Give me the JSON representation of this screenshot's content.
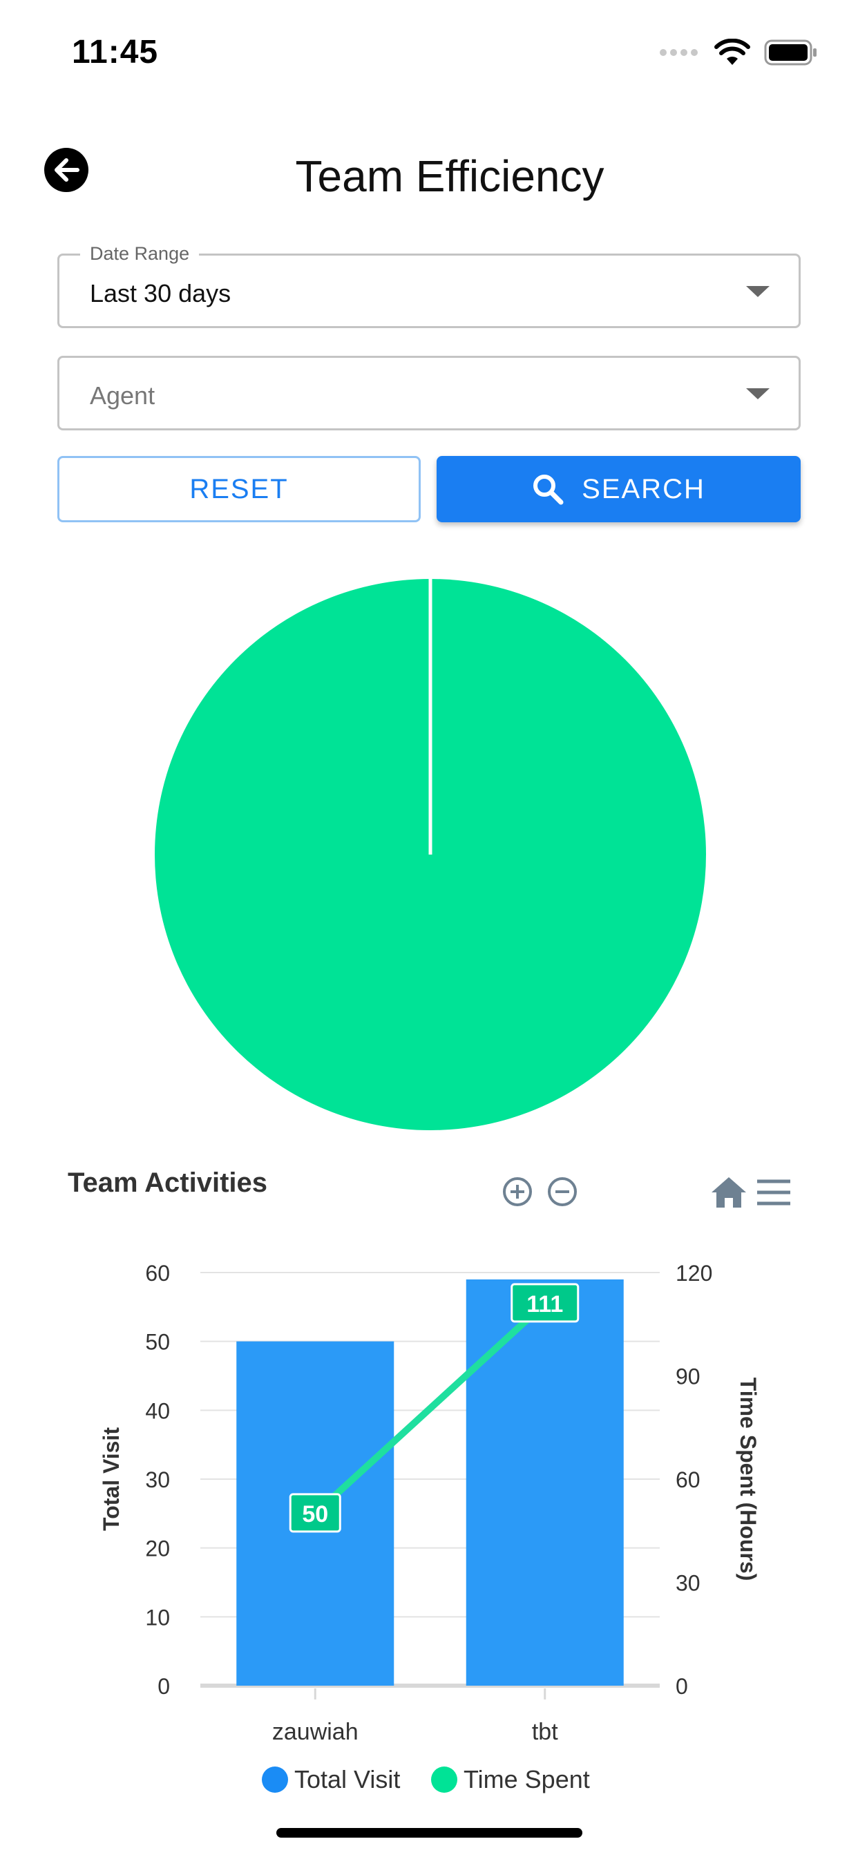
{
  "status_bar": {
    "time": "11:45"
  },
  "header": {
    "title": "Team Efficiency",
    "back_icon": "arrow-left-icon"
  },
  "filters": {
    "date_range": {
      "label": "Date Range",
      "value": "Last 30 days"
    },
    "agent": {
      "placeholder": "Agent",
      "value": ""
    }
  },
  "buttons": {
    "reset_label": "RESET",
    "search_label": "SEARCH"
  },
  "colors": {
    "accent": "#1a7ef2",
    "pie_green": "#00e396",
    "bar_blue": "#2b9af7",
    "line_green": "#1fdf9f"
  },
  "pie": {
    "slices": [
      {
        "label": "Time Spent",
        "value": 100
      }
    ]
  },
  "activities": {
    "title": "Team Activities",
    "tools": [
      "zoom-in-icon",
      "zoom-out-icon",
      "home-icon",
      "menu-icon"
    ]
  },
  "chart_data": {
    "type": "bar",
    "categories": [
      "zauwiah",
      "tbt"
    ],
    "series": [
      {
        "name": "Total Visit",
        "type": "bar",
        "axis": "left",
        "values": [
          50,
          59
        ]
      },
      {
        "name": "Time Spent",
        "type": "line",
        "axis": "right",
        "values": [
          50,
          111
        ],
        "data_labels": [
          "50",
          "111"
        ]
      }
    ],
    "ylabel": "Total Visit",
    "y2label": "Time Spent (Hours)",
    "ylim": [
      0,
      60
    ],
    "y2lim": [
      0,
      120
    ],
    "yticks": [
      "0",
      "10",
      "20",
      "30",
      "40",
      "50",
      "60"
    ],
    "y2ticks": [
      "0",
      "30",
      "60",
      "90",
      "120"
    ],
    "grid": true,
    "legend": "bottom-center"
  }
}
